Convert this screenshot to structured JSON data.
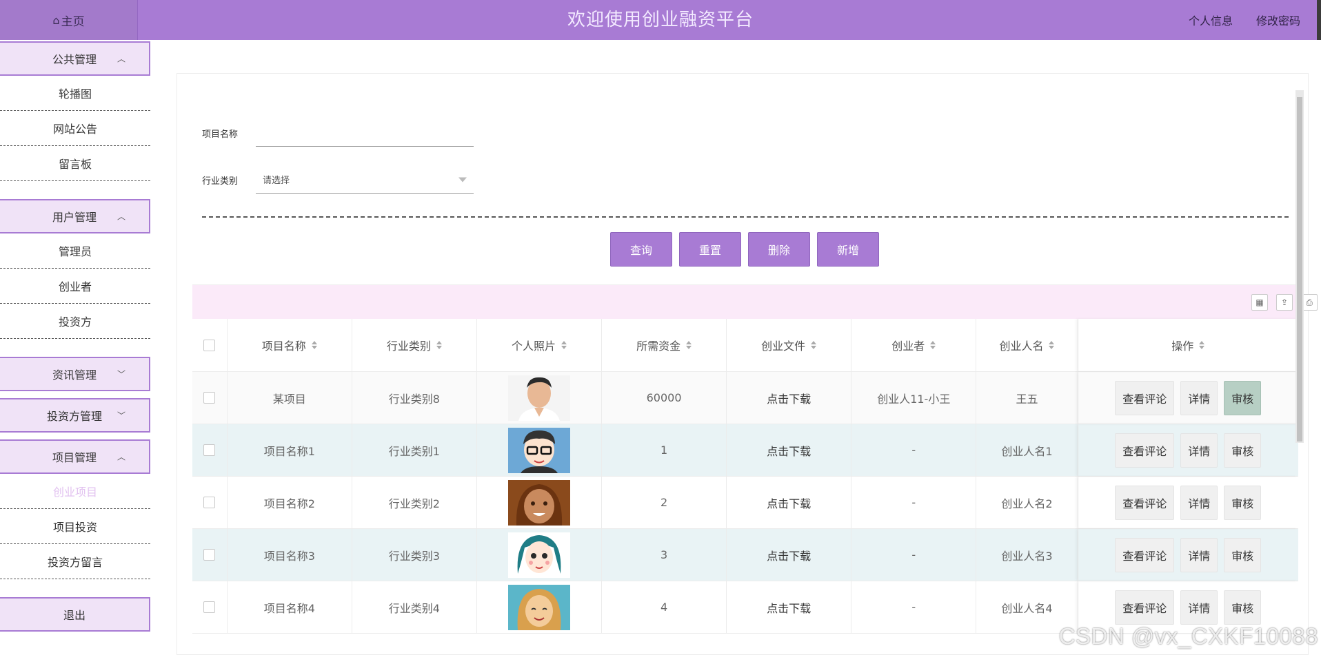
{
  "header": {
    "home_label": "主页",
    "title": "欢迎使用创业融资平台",
    "links": [
      "个人信息",
      "修改密码"
    ]
  },
  "sidebar": {
    "groups": [
      {
        "label": "公共管理",
        "expanded": true,
        "items": [
          "轮播图",
          "网站公告",
          "留言板"
        ]
      },
      {
        "label": "用户管理",
        "expanded": true,
        "items": [
          "管理员",
          "创业者",
          "投资方"
        ]
      },
      {
        "label": "资讯管理",
        "expanded": false,
        "items": []
      },
      {
        "label": "投资方管理",
        "expanded": false,
        "items": []
      },
      {
        "label": "项目管理",
        "expanded": true,
        "items": [
          "创业项目",
          "项目投资",
          "投资方留言"
        ],
        "active_item": "创业项目"
      }
    ],
    "logout": "退出"
  },
  "search": {
    "name_label": "项目名称",
    "name_value": "",
    "category_label": "行业类别",
    "category_placeholder": "请选择"
  },
  "actions": [
    "查询",
    "重置",
    "删除",
    "新增"
  ],
  "table": {
    "columns": [
      "项目名称",
      "行业类别",
      "个人照片",
      "所需资金",
      "创业文件",
      "创业者",
      "创业人名",
      "操作"
    ],
    "rows": [
      {
        "name": "某项目",
        "category": "行业类别8",
        "avatar": "man-portrait",
        "funds": "60000",
        "file": "点击下载",
        "founder": "创业人11-小王",
        "founder_name": "王五"
      },
      {
        "name": "项目名称1",
        "category": "行业类别1",
        "avatar": "cartoon-man-glasses",
        "funds": "1",
        "file": "点击下载",
        "founder": "-",
        "founder_name": "创业人名1"
      },
      {
        "name": "项目名称2",
        "category": "行业类别2",
        "avatar": "cartoon-woman-brown",
        "funds": "2",
        "file": "点击下载",
        "founder": "-",
        "founder_name": "创业人名2"
      },
      {
        "name": "项目名称3",
        "category": "行业类别3",
        "avatar": "cartoon-woman-teal",
        "funds": "3",
        "file": "点击下载",
        "founder": "-",
        "founder_name": "创业人名3"
      },
      {
        "name": "项目名称4",
        "category": "行业类别4",
        "avatar": "cartoon-woman-blonde",
        "funds": "4",
        "file": "点击下载",
        "founder": "-",
        "founder_name": "创业人名4"
      }
    ],
    "row_actions": [
      "查看评论",
      "详情",
      "审核"
    ]
  },
  "watermark": "CSDN @vx_CXKF10088",
  "colors": {
    "accent": "#a87bd4",
    "sidebar_header": "#f0e3f7",
    "toolbar": "#fbeaf9",
    "row_alt": "#e9f3f5"
  }
}
